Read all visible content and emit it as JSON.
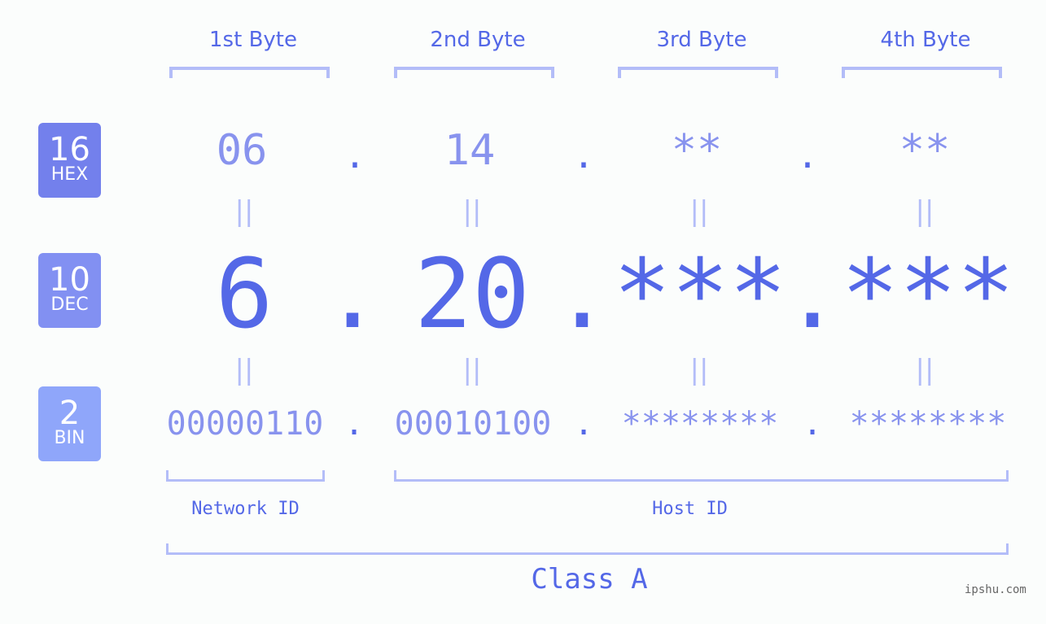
{
  "bytes": [
    {
      "label": "1st Byte",
      "hex": "06",
      "dec": "6",
      "bin": "00000110"
    },
    {
      "label": "2nd Byte",
      "hex": "14",
      "dec": "20",
      "bin": "00010100"
    },
    {
      "label": "3rd Byte",
      "hex": "**",
      "dec": "***",
      "bin": "********"
    },
    {
      "label": "4th Byte",
      "hex": "**",
      "dec": "***",
      "bin": "********"
    }
  ],
  "badges": {
    "hex": {
      "num": "16",
      "label": "HEX",
      "color": "#7380ec"
    },
    "dec": {
      "num": "10",
      "label": "DEC",
      "color": "#8290f2"
    },
    "bin": {
      "num": "2",
      "label": "BIN",
      "color": "#8fa6fa"
    }
  },
  "separator": ".",
  "equals": "||",
  "network_id_label": "Network ID",
  "host_id_label": "Host ID",
  "class_label": "Class A",
  "watermark": "ipshu.com",
  "colors": {
    "primary": "#5468e7",
    "secondary": "#8893ee",
    "bracket": "#b3bdf8",
    "background": "#fbfdfc"
  }
}
